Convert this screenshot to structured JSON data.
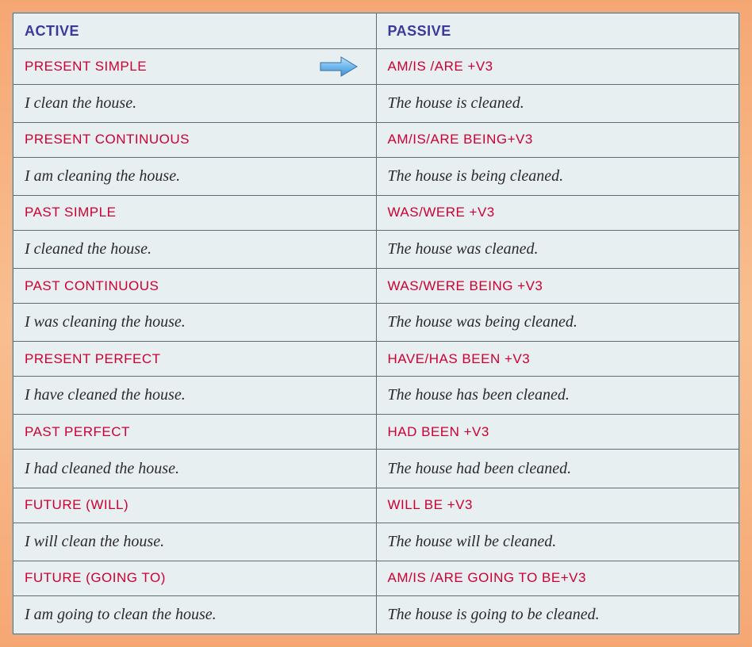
{
  "headers": {
    "active": "ACTIVE",
    "passive": "PASSIVE"
  },
  "rows": [
    {
      "activeTense": "PRESENT SIMPLE",
      "passiveForm": "AM/IS /ARE +V3",
      "activeExample": "I clean the house.",
      "passiveExample": "The house is cleaned.",
      "arrow": true
    },
    {
      "activeTense": "PRESENT CONTINUOUS",
      "passiveForm": "AM/IS/ARE BEING+V3",
      "activeExample": "I am cleaning the house.",
      "passiveExample": "The house is being cleaned."
    },
    {
      "activeTense": "PAST SIMPLE",
      "passiveForm": "WAS/WERE +V3",
      "activeExample": "I cleaned the house.",
      "passiveExample": "The house was cleaned."
    },
    {
      "activeTense": "PAST CONTINUOUS",
      "passiveForm": "WAS/WERE BEING +V3",
      "activeExample": "I was cleaning the house.",
      "passiveExample": "The house was being cleaned."
    },
    {
      "activeTense": "PRESENT PERFECT",
      "passiveForm": "HAVE/HAS BEEN +V3",
      "activeExample": "I have cleaned the house.",
      "passiveExample": "The house has been cleaned."
    },
    {
      "activeTense": "PAST PERFECT",
      "passiveForm": "HAD BEEN +V3",
      "activeExample": "I had cleaned the house.",
      "passiveExample": "The house had been cleaned."
    },
    {
      "activeTense": "FUTURE (WILL)",
      "passiveForm": "WILL BE +V3",
      "activeExample": "I will clean the house.",
      "passiveExample": "The house will be cleaned."
    },
    {
      "activeTense": "FUTURE (GOING TO)",
      "passiveForm": "AM/IS /ARE GOING TO BE+V3",
      "activeExample": "I am going to clean the house.",
      "passiveExample": "The house is going to be cleaned."
    }
  ]
}
